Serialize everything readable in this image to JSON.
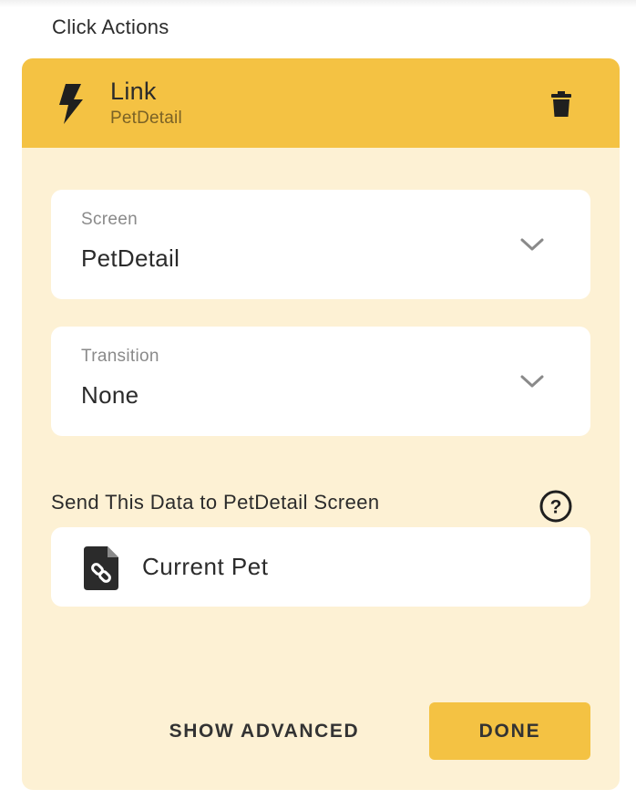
{
  "section": {
    "title": "Click Actions"
  },
  "action": {
    "title": "Link",
    "subtitle": "PetDetail",
    "icon": "bolt-icon",
    "delete_icon": "trash-icon",
    "colors": {
      "header": "#f4c243",
      "body": "#fdf1d4"
    }
  },
  "fields": [
    {
      "label": "Screen",
      "value": "PetDetail",
      "icon": "chevron-down-icon"
    },
    {
      "label": "Transition",
      "value": "None",
      "icon": "chevron-down-icon"
    }
  ],
  "send_data": {
    "label": "Send This Data to PetDetail Screen",
    "help_icon": "help-icon",
    "item": {
      "label": "Current Pet",
      "icon": "file-link-icon"
    }
  },
  "buttons": {
    "advanced": "SHOW ADVANCED",
    "done": "DONE"
  }
}
